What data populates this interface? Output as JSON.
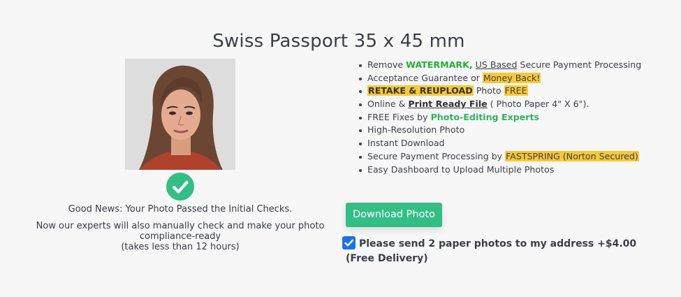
{
  "page": {
    "title": "Swiss Passport 35 x 45 mm"
  },
  "photo": {
    "alt_icon": "portrait-photo"
  },
  "status": {
    "check_icon": "check-circle-icon",
    "line1": "Good News: Your Photo Passed the Initial Checks.",
    "line2a": "Now our experts will also manually check and make your photo",
    "line2b": "compliance-ready",
    "line2c": "(takes less than 12 hours)"
  },
  "features": {
    "f1": {
      "prefix": "Remove ",
      "highlight": "WATERMARK,",
      "mid": " ",
      "underline": "US Based",
      "suffix": " Secure Payment Processing"
    },
    "f2": {
      "prefix": "Acceptance Guarantee or ",
      "highlight": "Money Back!"
    },
    "f3": {
      "highlight": "RETAKE & REUPLOAD",
      "mid": " Photo ",
      "highlight2": "FREE"
    },
    "f4": {
      "prefix": "Online & ",
      "bold": "Print Ready File",
      "suffix": " ( Photo Paper 4\" X 6\")."
    },
    "f5": {
      "prefix": "FREE Fixes by ",
      "bold": "Photo-Editing Experts"
    },
    "f6": {
      "text": "High-Resolution Photo"
    },
    "f7": {
      "text": "Instant Download"
    },
    "f8": {
      "prefix": "Secure Payment Processing by ",
      "highlight": "FASTSPRING (Norton Secured)"
    },
    "f9": {
      "text": "Easy Dashboard to Upload Multiple Photos"
    }
  },
  "actions": {
    "download_label": "Download Photo",
    "paper_option_label": "Please send 2 paper photos to my address +$4.00 (Free Delivery)",
    "paper_option_checked": true
  },
  "colors": {
    "accent": "#31bf86",
    "highlight": "#f7c936",
    "checkbox": "#1a73e8"
  }
}
